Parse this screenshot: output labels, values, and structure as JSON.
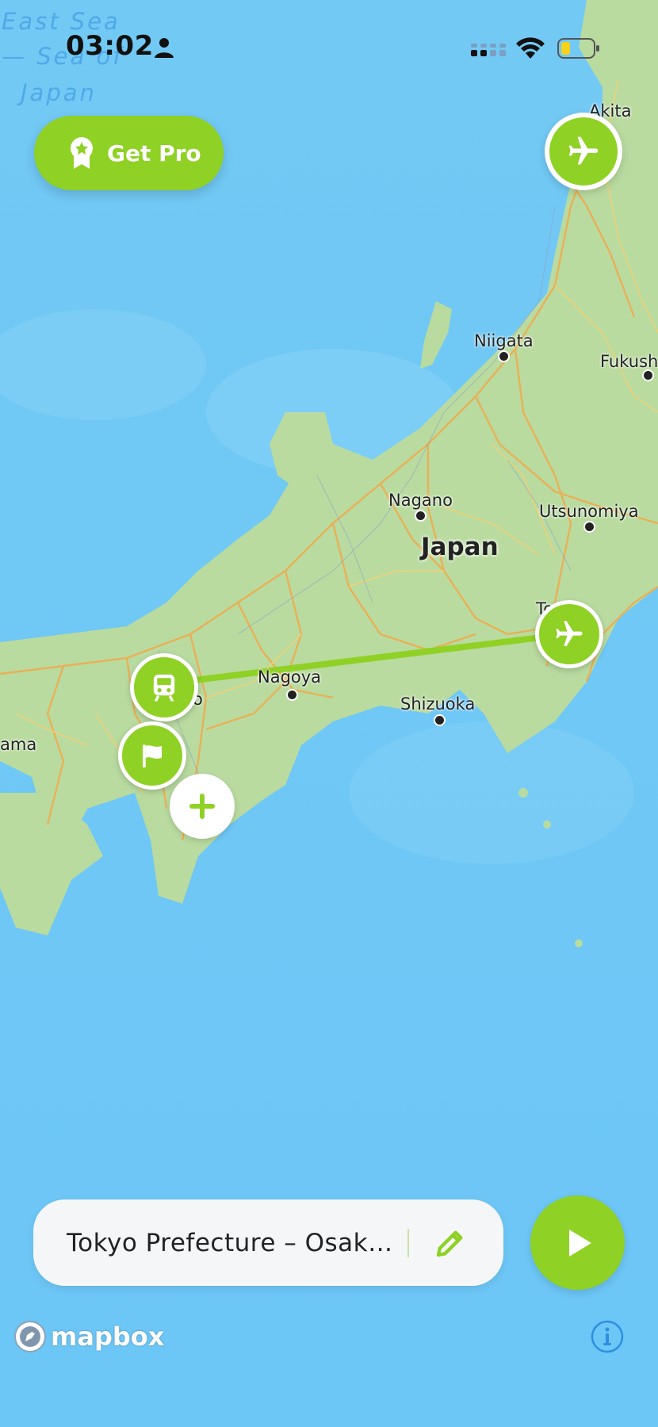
{
  "status_bar": {
    "time": "03:02"
  },
  "map": {
    "sea_labels": [
      "East Sea",
      "— Sea of",
      "Japan"
    ],
    "country_label": "Japan",
    "cities": [
      {
        "id": "akita",
        "name": "Akita"
      },
      {
        "id": "niigata",
        "name": "Niigata"
      },
      {
        "id": "fukushima",
        "name": "Fukush"
      },
      {
        "id": "nagano",
        "name": "Nagano"
      },
      {
        "id": "utsunomiya",
        "name": "Utsunomiya"
      },
      {
        "id": "tokyo",
        "name": "To…o"
      },
      {
        "id": "nagoya",
        "name": "Nagoya"
      },
      {
        "id": "shizuoka",
        "name": "Shizuoka"
      },
      {
        "id": "kyoto",
        "name": "…o"
      },
      {
        "id": "okayama",
        "name": "ama"
      }
    ],
    "route_color": "#8fd124"
  },
  "pro_button": {
    "label": "Get Pro"
  },
  "route_bar": {
    "text": "Tokyo Prefecture  –  Osak…"
  },
  "attribution": {
    "brand": "mapbox"
  },
  "colors": {
    "accent": "#8fd124",
    "sea": "#6ec8f4",
    "land": "#b9dba0"
  }
}
